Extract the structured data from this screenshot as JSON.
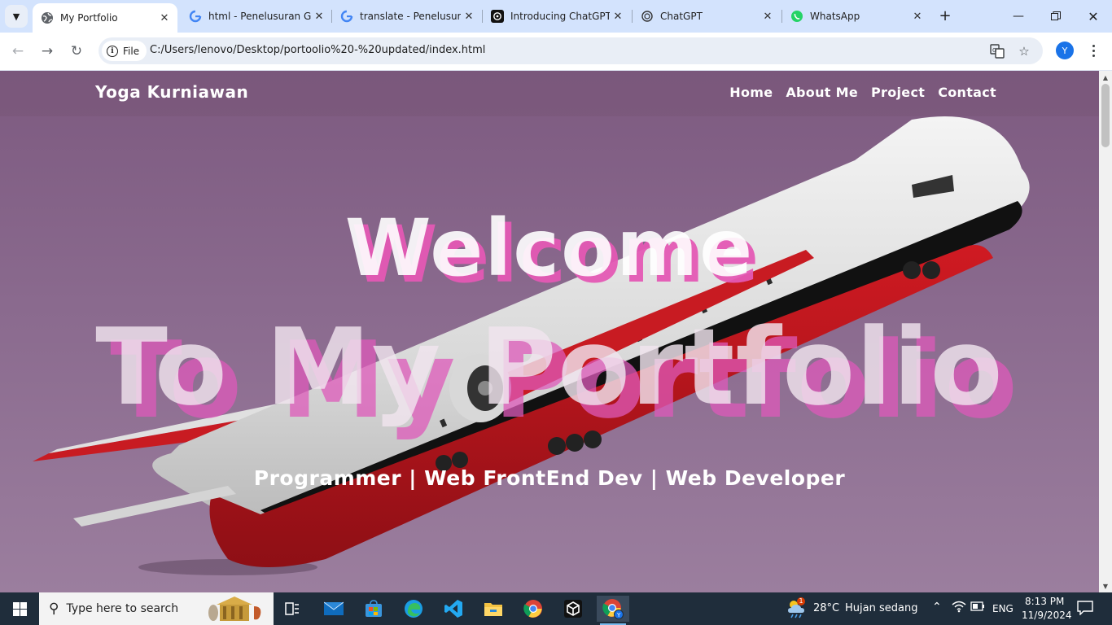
{
  "browser": {
    "tabs": [
      {
        "title": "My Portfolio",
        "icon": "globe-icon",
        "active": true
      },
      {
        "title": "html - Penelusuran Google",
        "icon": "google-icon",
        "active": false
      },
      {
        "title": "translate - Penelusuran",
        "icon": "google-icon",
        "active": false
      },
      {
        "title": "Introducing ChatGPT",
        "icon": "openai-icon",
        "active": false
      },
      {
        "title": "ChatGPT",
        "icon": "openai-icon",
        "active": false
      },
      {
        "title": "WhatsApp",
        "icon": "whatsapp-icon",
        "active": false
      }
    ],
    "address": {
      "chip_label": "File",
      "url": "C:/Users/lenovo/Desktop/portoolio%20-%20updated/index.html"
    },
    "profile_initial": "Y"
  },
  "page": {
    "brand": "Yoga Kurniawan",
    "nav": [
      "Home",
      "About Me",
      "Project",
      "Contact"
    ],
    "hero_line1": "Welcome",
    "hero_line2": "To My Portfolio",
    "hero_subtitle": "Programmer | Web FrontEnd Dev | Web Developer"
  },
  "taskbar": {
    "search_placeholder": "Type here to search",
    "weather_temp": "28°C",
    "weather_desc": "Hujan sedang",
    "weather_badge": "1",
    "language": "ENG",
    "time": "8:13 PM",
    "date": "11/9/2024",
    "apps": [
      "task-view-icon",
      "mail-icon",
      "store-icon",
      "edge-icon",
      "vscode-icon",
      "file-explorer-icon",
      "chrome-icon",
      "roblox-studio-icon",
      "chrome-profile-icon"
    ]
  },
  "colors": {
    "tabstrip": "#d3e3fd",
    "hero_shadow": "#e458b4",
    "page_bg": "#8a6a8e",
    "taskbar": "#1f2d3b"
  }
}
